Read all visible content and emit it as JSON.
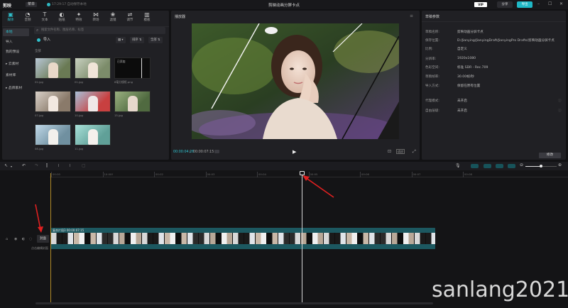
{
  "titlebar": {
    "logo": "剪映",
    "menu": "菜单",
    "status": "17:29:17 自动保存本地",
    "title": "剪映动画分屏卡点",
    "pro_badge": "VIP",
    "share": "分享",
    "export": "导出",
    "colors": {
      "accent": "#1fb8c6"
    }
  },
  "media_panel": {
    "toolbar": [
      {
        "label": "媒体",
        "icon": "media-icon",
        "active": true
      },
      {
        "label": "音频",
        "icon": "audio-icon",
        "active": false
      },
      {
        "label": "文本",
        "icon": "text-icon",
        "active": false
      },
      {
        "label": "贴纸",
        "icon": "sticker-icon",
        "active": false
      },
      {
        "label": "特效",
        "icon": "effects-icon",
        "active": false
      },
      {
        "label": "转场",
        "icon": "transition-icon",
        "active": false
      },
      {
        "label": "滤镜",
        "icon": "filter-icon",
        "active": false
      },
      {
        "label": "调节",
        "icon": "adjust-icon",
        "active": false
      },
      {
        "label": "模板",
        "icon": "template-icon",
        "active": false
      }
    ],
    "nav": [
      {
        "label": "本地",
        "active": true
      },
      {
        "label": "导入",
        "active": false
      },
      {
        "label": "我的预设",
        "active": false
      },
      {
        "label": "▸ 云素材",
        "active": false
      },
      {
        "label": "素材库",
        "active": false
      },
      {
        "label": "▸ 品牌素材",
        "active": false
      }
    ],
    "search_placeholder": "搜索文件名称、图层名称、标签",
    "import_label": "导入",
    "grid_tools": [
      "▦ ▾",
      "排序 ⇅",
      "全部 ⇅"
    ],
    "section_label": "全部",
    "items": [
      {
        "name": "02.jpg",
        "kind": "photo"
      },
      {
        "name": "01.jpg",
        "kind": "photo"
      },
      {
        "name": "8毫分镜框.png",
        "kind": "frame",
        "overlay": "已添加"
      },
      {
        "name": "07.jpg",
        "kind": "photo"
      },
      {
        "name": "10.jpg",
        "kind": "photo"
      },
      {
        "name": "15.jpg",
        "kind": "photo"
      },
      {
        "name": "08.jpg",
        "kind": "photo"
      },
      {
        "name": "11.jpg",
        "kind": "photo"
      }
    ]
  },
  "player": {
    "title": "播放器",
    "time_current": "00:00:04:26",
    "time_separator": "/",
    "time_total": "00:00:07:15",
    "fit_label": "适应",
    "menu_icon": "hamburger-icon"
  },
  "draft": {
    "title": "草稿参数",
    "props": [
      {
        "label": "草稿名称:",
        "value": "剪映动画分屏卡点",
        "info": false
      },
      {
        "label": "保存位置:",
        "value": "D:/Jianying/JianyingDraft/JianyingPro Drafts/剪映动画分屏卡点",
        "info": false
      },
      {
        "label": "比例:",
        "value": "自定义",
        "info": false
      },
      {
        "label": "分辨率:",
        "value": "1920x1080",
        "info": false
      },
      {
        "label": "色彩空间:",
        "value": "标准 SDR - Rec.709",
        "info": false
      },
      {
        "label": "草稿帧率:",
        "value": "30.00帧/秒",
        "info": false
      },
      {
        "label": "导入方式:",
        "value": "保留在原有位置",
        "info": false
      },
      {
        "label": "代理模式:",
        "value": "未开启",
        "info": true
      },
      {
        "label": "自由层级:",
        "value": "未开启",
        "info": true
      }
    ],
    "modify_button": "修改"
  },
  "timeline": {
    "ruler": [
      "00:00",
      "10:00f",
      "00:02",
      "00:03",
      "00:04",
      "00:05",
      "00:06",
      "00:07",
      "00:08"
    ],
    "cover_label": "封面",
    "cover_tip": "点击编辑封面",
    "clip_label": "复合片段3  00:00:07:15",
    "playhead_seconds": 4.87,
    "zoom_level": 0.5
  },
  "watermark": "sanlang2021"
}
